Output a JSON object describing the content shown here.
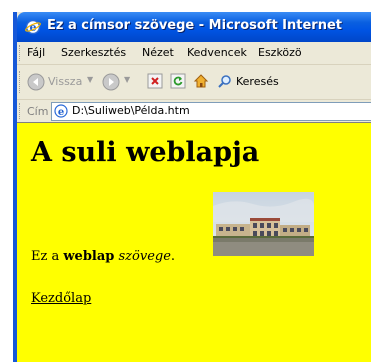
{
  "window": {
    "title": "Ez a címsor szövege - Microsoft Internet"
  },
  "menubar": {
    "items": [
      "Fájl",
      "Szerkesztés",
      "Nézet",
      "Kedvencek",
      "Eszközö"
    ]
  },
  "toolbar": {
    "back_label": "Vissza",
    "search_label": "Keresés"
  },
  "addressbar": {
    "label": "Cím",
    "value": "D:\\Suliweb\\Példa.htm"
  },
  "page": {
    "heading": "A suli weblapja",
    "paragraph_prefix": "Ez a ",
    "paragraph_bold": "weblap",
    "paragraph_italic": "szövege",
    "paragraph_suffix": ".",
    "link_text": "Kezdőlap"
  },
  "colors": {
    "page_background": "#ffff00",
    "titlebar": "#0054e3"
  }
}
